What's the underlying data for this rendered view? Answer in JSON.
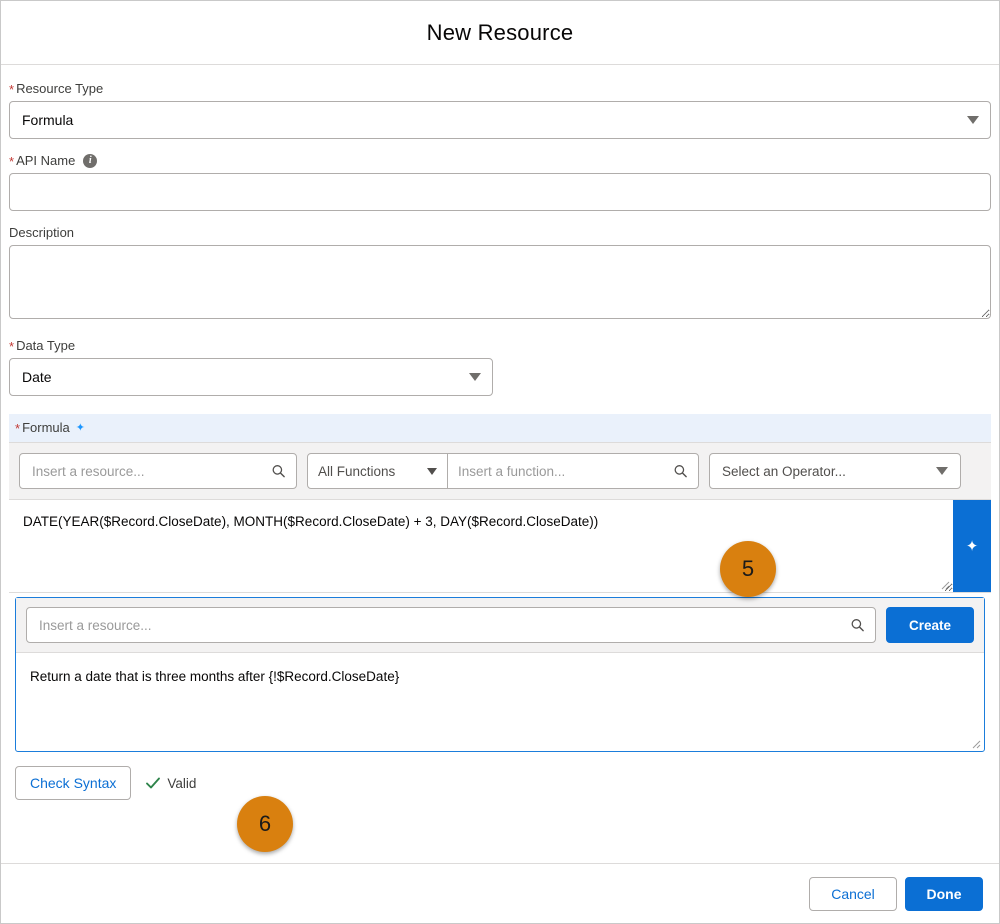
{
  "header": {
    "title": "New Resource"
  },
  "form": {
    "resource_type": {
      "label": "Resource Type",
      "required_marker": "*",
      "value": "Formula"
    },
    "api_name": {
      "label": "API Name",
      "required_marker": "*",
      "info_icon": "info-icon",
      "value": "",
      "placeholder": ""
    },
    "description": {
      "label": "Description",
      "value": "",
      "placeholder": ""
    },
    "data_type": {
      "label": "Data Type",
      "required_marker": "*",
      "value": "Date"
    },
    "formula": {
      "label": "Formula",
      "required_marker": "*",
      "sparkle_icon": "sparkle-icon",
      "toolbar": {
        "insert_resource_placeholder": "Insert a resource...",
        "all_functions_label": "All Functions",
        "insert_function_placeholder": "Insert a function...",
        "select_operator_label": "Select an Operator...",
        "search_icon": "search-icon",
        "chevron_down_icon": "chevron-down-icon"
      },
      "editor_value": "DATE(YEAR($Record.CloseDate), MONTH($Record.CloseDate) + 3, DAY($Record.CloseDate))",
      "einstein_rail_icon": "sparkle-ai-icon"
    },
    "einstein_panel": {
      "insert_resource_placeholder": "Insert a resource...",
      "search_icon": "search-icon",
      "create_label": "Create",
      "prompt_text": "Return a date that is three months after {!$Record.CloseDate}"
    },
    "syntax": {
      "check_syntax_label": "Check Syntax",
      "status_icon": "check-mark-icon",
      "status_text": "Valid"
    }
  },
  "footer": {
    "cancel_label": "Cancel",
    "done_label": "Done"
  },
  "annotations": [
    {
      "id": "badge5",
      "number": "5"
    },
    {
      "id": "badge6",
      "number": "6"
    }
  ],
  "colors": {
    "brand_blue": "#0b6fd4",
    "required_red": "#c23934",
    "valid_green": "#2e844a",
    "annotation_orange": "#d9800f",
    "formula_band_blue": "#eaf1fb",
    "toolbar_gray": "#f3f2f2"
  }
}
